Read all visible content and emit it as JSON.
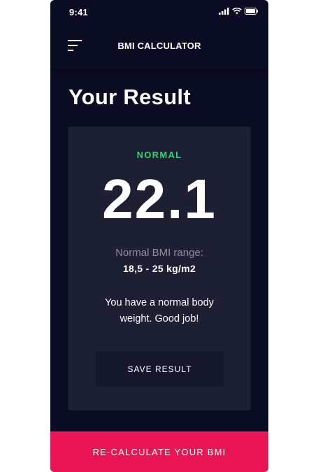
{
  "status_bar": {
    "time": "9:41",
    "icons": [
      "signal-icon",
      "wifi-icon",
      "battery-icon"
    ]
  },
  "app_bar": {
    "title": "BMI CALCULATOR",
    "menu_icon": "menu-icon"
  },
  "page": {
    "title": "Your Result"
  },
  "result": {
    "status": "NORMAL",
    "value": "22.1",
    "range_label": "Normal BMI range:",
    "range_value": "18,5 - 25 kg/m2",
    "message": "You have a normal body weight. Good job!",
    "save_label": "SAVE RESULT"
  },
  "footer": {
    "recalculate_label": "RE-CALCULATE YOUR BMI"
  },
  "colors": {
    "background": "#090c22",
    "card": "#1d1f33",
    "accent": "#eb1555",
    "status_normal": "#24d876"
  }
}
